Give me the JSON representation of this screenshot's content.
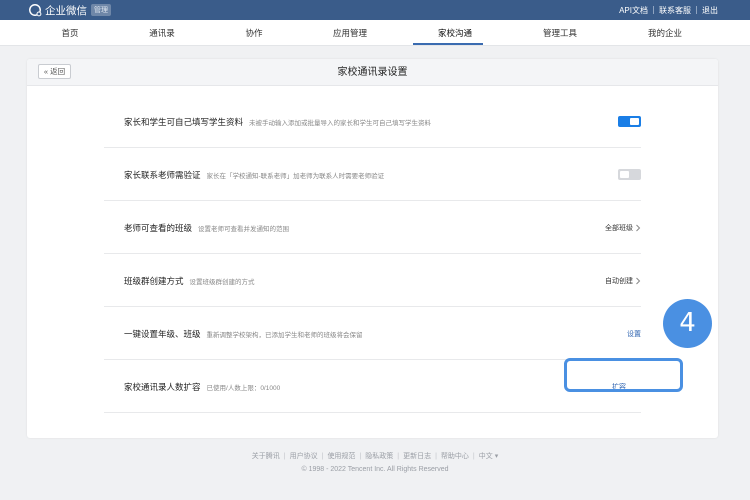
{
  "topbar": {
    "brand": "企业微信",
    "badge": "管理",
    "links": [
      "API文档",
      "联系客服",
      "退出"
    ]
  },
  "nav": {
    "items": [
      "首页",
      "通讯录",
      "协作",
      "应用管理",
      "家校沟通",
      "管理工具",
      "我的企业"
    ],
    "active": "家校沟通"
  },
  "panel": {
    "back_label": "« 返回",
    "title": "家校通讯录设置"
  },
  "settings": [
    {
      "label": "家长和学生可自己填写学生资料",
      "desc": "未被手动输入添加或批量导入的家长和学生可自己填写学生资料",
      "type": "toggle",
      "enabled": true
    },
    {
      "label": "家长联系老师需验证",
      "desc": "家长在「学校通知-联系老师」加老师为联系人时需要老师验证",
      "type": "toggle",
      "enabled": false
    },
    {
      "label": "老师可查看的班级",
      "desc": "设置老师可查看并发通知的范围",
      "type": "select",
      "value": "全部班级"
    },
    {
      "label": "班级群创建方式",
      "desc": "设置班级群创建的方式",
      "type": "select",
      "value": "自动创建"
    },
    {
      "label": "一键设置年级、班级",
      "desc": "重新调整学校架构，已添加学生和老师的班级将会保留",
      "type": "link",
      "value": "设置"
    },
    {
      "label": "家校通讯录人数扩容",
      "desc": "已使用/人数上限：0/1000",
      "type": "link",
      "value": "扩容"
    }
  ],
  "annotation": {
    "step_number": "4",
    "color": "#4a90e2"
  },
  "footer": {
    "links": [
      "关于腾讯",
      "用户协议",
      "使用规范",
      "隐私政策",
      "更新日志",
      "帮助中心",
      "中文 ▾"
    ],
    "copyright": "© 1998 - 2022 Tencent Inc. All Rights Reserved"
  },
  "colors": {
    "topbar": "#3a5c8a",
    "accent": "#1a7ee6",
    "link": "#2e63b0"
  }
}
